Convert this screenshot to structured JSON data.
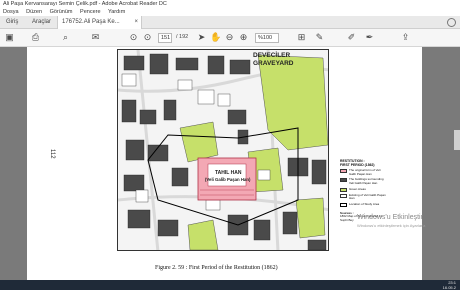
{
  "window": {
    "title": "Ali Paşa Kervansarayı Semin Çelik.pdf - Adobe Acrobat Reader DC"
  },
  "menu": {
    "items": [
      "Dosya",
      "Düzen",
      "Görünüm",
      "Pencere",
      "Yardım"
    ]
  },
  "tabs": {
    "home": "Giriş",
    "tools": "Araçlar",
    "doc": "176752.Ali Paşa Ke...",
    "close": "×"
  },
  "toolbar": {
    "page_current": "151",
    "page_total": "/ 192",
    "zoom": "%100"
  },
  "page": {
    "page_number": "112",
    "caption": "Figure 2. 59 : First Period of the Restitution (1862)"
  },
  "map": {
    "label_graveyard": "DEVECİLER\nGRAVEYARD",
    "label_graveyard_1": "DEVECİLER",
    "label_graveyard_2": "GRAVEYARD",
    "label_han_1": "TAHIL HAN",
    "label_han_2": "(Veli Galib Paşan Han)"
  },
  "legend": {
    "title_1": "RESTITUTION :",
    "title_2": "FIRST PERIOD (1862)",
    "items": [
      "The original form of Veli Galib Paşan Han",
      "The buildings surrounding Veli Galib Paşan Han",
      "Green Areas",
      "Existing of Veli Galib Paşan Han",
      "Location of Study Area"
    ],
    "source_label": "Sources :",
    "source_text": "1862 Map of Bursa prepared by Suphi Bey",
    "colors": [
      "#f3a8b4",
      "#4a4a4a",
      "#c6e06a",
      "#ffffff",
      "#000000"
    ]
  },
  "watermark": {
    "line1": "Windows'u Etkinleştir",
    "line2": "Windows'u etkinleştirmek için Ayarlar'a"
  },
  "tray": {
    "time": "23:1",
    "date": "16.05.2"
  }
}
